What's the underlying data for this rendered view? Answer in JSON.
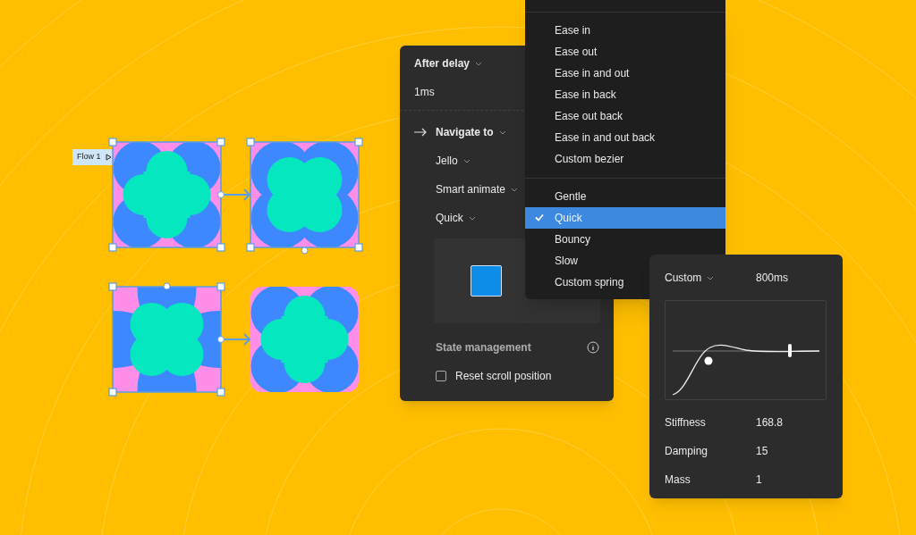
{
  "flow_label": "Flow 1",
  "frames": [
    {
      "kind": "petals",
      "selected": true
    },
    {
      "kind": "clover",
      "selected": true
    },
    {
      "kind": "cross",
      "selected": true
    },
    {
      "kind": "rounded",
      "selected": false
    }
  ],
  "interaction_panel": {
    "trigger": "After delay",
    "delay": "1ms",
    "action": "Navigate to",
    "destination": "Jello",
    "animation": "Smart animate",
    "easing": "Quick",
    "section_title": "State management",
    "checkbox": {
      "label": "Reset scroll position",
      "checked": false
    }
  },
  "easing_menu": {
    "groups": [
      [
        {
          "label": "Ease in",
          "selected": false
        },
        {
          "label": "Ease out",
          "selected": false
        },
        {
          "label": "Ease in and out",
          "selected": false
        },
        {
          "label": "Ease in back",
          "selected": false
        },
        {
          "label": "Ease out back",
          "selected": false
        },
        {
          "label": "Ease in and out back",
          "selected": false
        },
        {
          "label": "Custom bezier",
          "selected": false
        }
      ],
      [
        {
          "label": "Gentle",
          "selected": false
        },
        {
          "label": "Quick",
          "selected": true
        },
        {
          "label": "Bouncy",
          "selected": false
        },
        {
          "label": "Slow",
          "selected": false
        },
        {
          "label": "Custom spring",
          "selected": false
        }
      ]
    ]
  },
  "spring_panel": {
    "preset": "Custom",
    "duration": "800ms",
    "fields": [
      {
        "label": "Stiffness",
        "value": "168.8"
      },
      {
        "label": "Damping",
        "value": "15"
      },
      {
        "label": "Mass",
        "value": "1"
      }
    ]
  }
}
